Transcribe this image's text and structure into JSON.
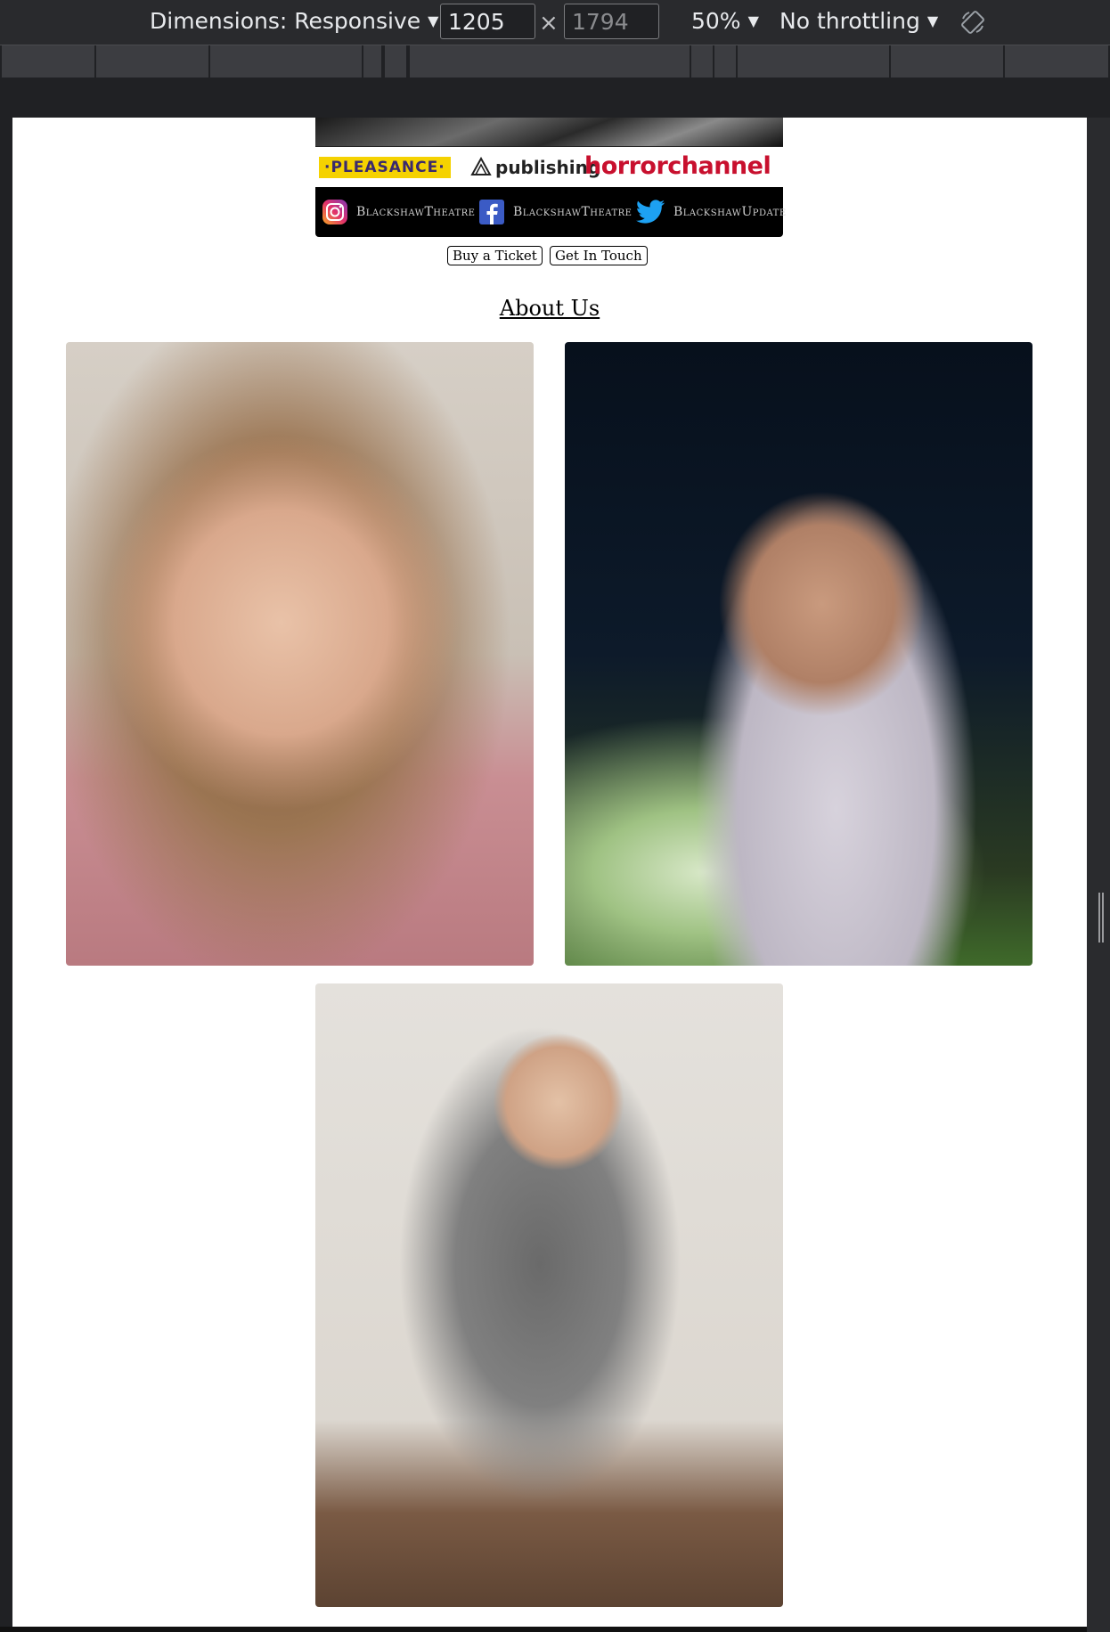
{
  "devtools": {
    "dimensions_label": "Dimensions: Responsive",
    "width_value": "1205",
    "height_value": "1794",
    "zoom_label": "50%",
    "throttle_label": "No throttling"
  },
  "page": {
    "sponsors": {
      "pleasance": "·PLEASANCE·",
      "publishing": "publishing",
      "horror": "horrorchannel"
    },
    "social": [
      {
        "network": "instagram",
        "handle": "BlackshawTheatre"
      },
      {
        "network": "facebook",
        "handle": "BlackshawTheatre"
      },
      {
        "network": "twitter",
        "handle": "BlackshawUpdate"
      }
    ],
    "buttons": {
      "buy_ticket": "Buy a Ticket",
      "get_in_touch": "Get In Touch"
    },
    "about_heading": "About Us"
  },
  "icons": [
    "chevron-down-icon",
    "rotate-icon",
    "instagram-icon",
    "facebook-icon",
    "twitter-icon"
  ]
}
